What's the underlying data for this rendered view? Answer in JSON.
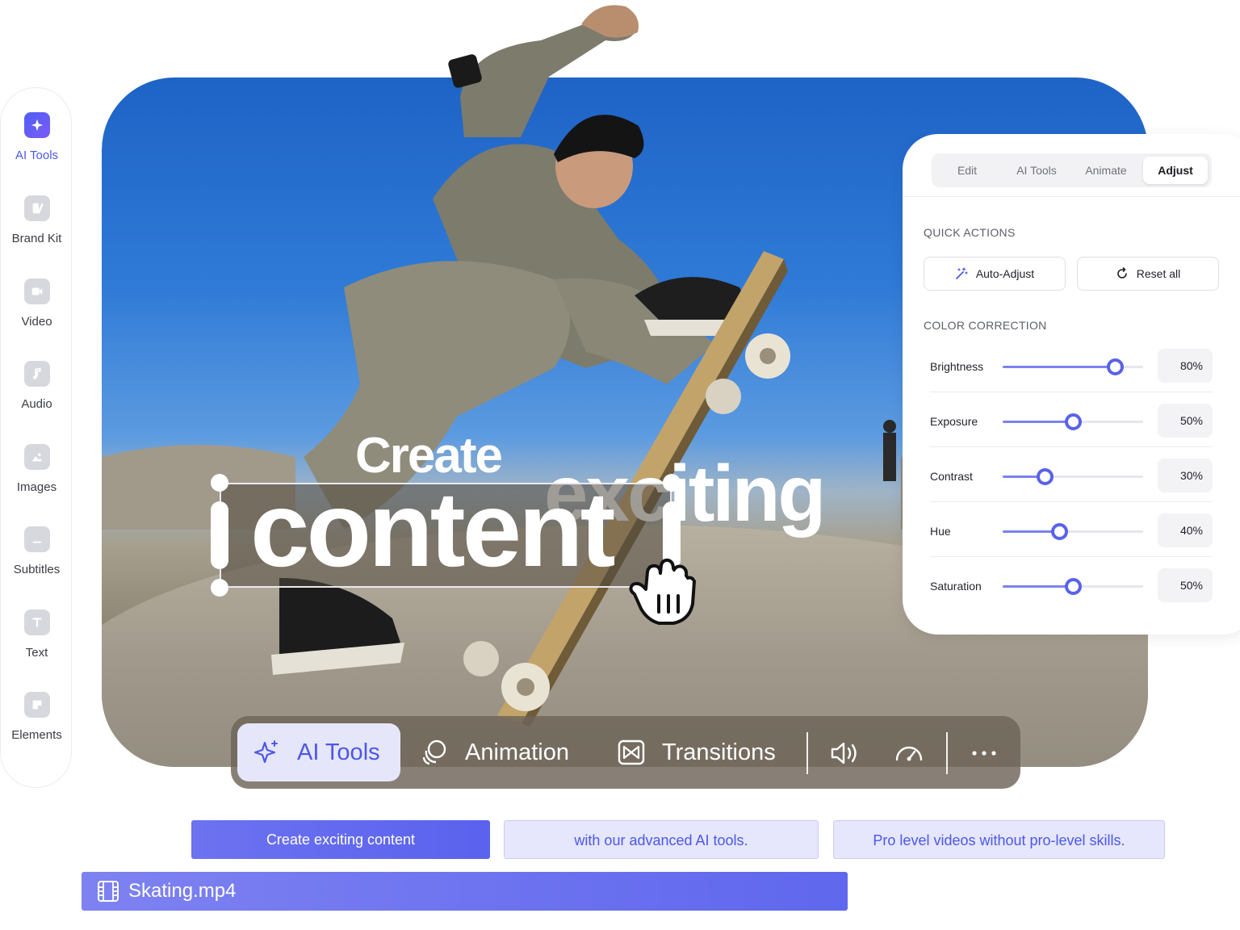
{
  "sidebar": {
    "items": [
      {
        "label": "AI Tools",
        "icon": "sparkle-icon",
        "active": true
      },
      {
        "label": "Brand Kit",
        "icon": "brand-kit-icon"
      },
      {
        "label": "Video",
        "icon": "video-camera-icon"
      },
      {
        "label": "Audio",
        "icon": "music-note-icon"
      },
      {
        "label": "Images",
        "icon": "image-icon"
      },
      {
        "label": "Subtitles",
        "icon": "subtitles-icon"
      },
      {
        "label": "Text",
        "icon": "text-icon"
      },
      {
        "label": "Elements",
        "icon": "elements-icon"
      }
    ]
  },
  "canvas": {
    "line1": "Create",
    "line2": "exciting",
    "line3": "content"
  },
  "toolbar": {
    "ai_tools_label": "AI Tools",
    "animation_label": "Animation",
    "transitions_label": "Transitions",
    "icons": [
      "sparkle-icon",
      "animation-icon",
      "transitions-icon",
      "volume-icon",
      "speed-icon",
      "more-icon"
    ]
  },
  "panel": {
    "tabs": [
      "Edit",
      "AI Tools",
      "Animate",
      "Adjust"
    ],
    "active_tab": "Adjust",
    "quick_actions_title": "QUICK ACTIONS",
    "auto_adjust_label": "Auto-Adjust",
    "reset_label": "Reset all",
    "color_correction_title": "COLOR CORRECTION",
    "sliders": [
      {
        "label": "Brightness",
        "value": 80,
        "display": "80%"
      },
      {
        "label": "Exposure",
        "value": 50,
        "display": "50%"
      },
      {
        "label": "Contrast",
        "value": 30,
        "display": "30%"
      },
      {
        "label": "Hue",
        "value": 40,
        "display": "40%"
      },
      {
        "label": "Saturation",
        "value": 50,
        "display": "50%"
      }
    ]
  },
  "timeline": {
    "text_clips": [
      "Create exciting content",
      "with our advanced AI tools.",
      "Pro level videos without pro-level skills."
    ],
    "video_clip": "Skating.mp4"
  },
  "colors": {
    "accent": "#5862e9",
    "accent_light": "#e6e6fc",
    "sky": "#2f7ad7"
  }
}
